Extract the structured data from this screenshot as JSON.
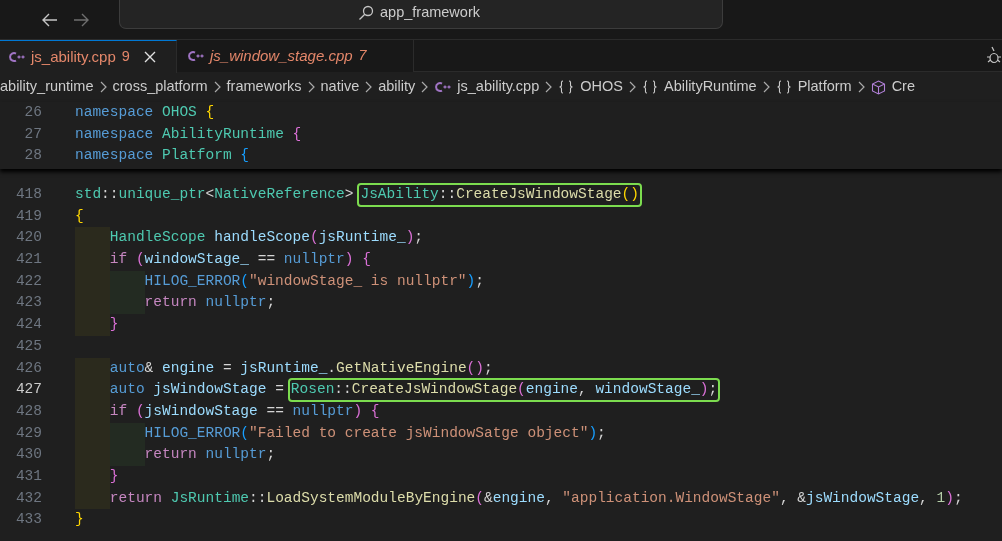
{
  "title_bar": {
    "search": "app_framework"
  },
  "tabs": [
    {
      "label": "js_ability.cpp",
      "badge": "9",
      "selected": true,
      "preview": false
    },
    {
      "label": "js_window_stage.cpp",
      "badge": "7",
      "selected": false,
      "preview": true
    }
  ],
  "breadcrumb": [
    {
      "kind": "folder",
      "label": "ability_runtime"
    },
    {
      "kind": "folder",
      "label": "cross_platform"
    },
    {
      "kind": "folder",
      "label": "frameworks"
    },
    {
      "kind": "folder",
      "label": "native"
    },
    {
      "kind": "folder",
      "label": "ability"
    },
    {
      "kind": "file",
      "label": "js_ability.cpp"
    },
    {
      "kind": "namespace",
      "label": "OHOS"
    },
    {
      "kind": "namespace",
      "label": "AbilityRuntime"
    },
    {
      "kind": "namespace",
      "label": "Platform"
    },
    {
      "kind": "symbol",
      "label": "Cre"
    }
  ],
  "sticky_lines": [
    {
      "num": "26",
      "code": [
        {
          "text": "namespace ",
          "kind": "kw"
        },
        {
          "text": "OHOS ",
          "kind": "type"
        },
        {
          "text": "{",
          "kind": "b1"
        }
      ]
    },
    {
      "num": "27",
      "code": [
        {
          "text": "namespace ",
          "kind": "kw"
        },
        {
          "text": "AbilityRuntime ",
          "kind": "type"
        },
        {
          "text": "{",
          "kind": "b2"
        }
      ]
    },
    {
      "num": "28",
      "code": [
        {
          "text": "namespace ",
          "kind": "kw"
        },
        {
          "text": "Platform ",
          "kind": "type"
        },
        {
          "text": "{",
          "kind": "b3"
        }
      ]
    }
  ],
  "lines": [
    {
      "num": "418",
      "current": false,
      "code": [
        {
          "text": "std",
          "kind": "type"
        },
        {
          "text": "::",
          "kind": "p"
        },
        {
          "text": "unique_ptr",
          "kind": "type"
        },
        {
          "text": "<",
          "kind": "p"
        },
        {
          "text": "NativeReference",
          "kind": "type"
        },
        {
          "text": ">",
          "kind": "p"
        }
      ],
      "boxed": [
        {
          "text": "JsAbility",
          "kind": "type"
        },
        {
          "text": "::",
          "kind": "p"
        },
        {
          "text": "CreateJsWindowStage",
          "kind": "fn"
        },
        {
          "text": "()",
          "kind": "b1"
        }
      ]
    },
    {
      "num": "419",
      "current": false,
      "code": [
        {
          "text": "{",
          "kind": "b1"
        }
      ]
    },
    {
      "num": "420",
      "current": false,
      "code": [
        {
          "text": "    HandleScope ",
          "kind": "type"
        },
        {
          "text": "handleScope",
          "kind": "var"
        },
        {
          "text": "(",
          "kind": "b2"
        },
        {
          "text": "jsRuntime_",
          "kind": "var"
        },
        {
          "text": ")",
          "kind": "b2"
        },
        {
          "text": ";",
          "kind": "p"
        }
      ]
    },
    {
      "num": "421",
      "current": false,
      "code": [
        {
          "text": "    if ",
          "kind": "ctl"
        },
        {
          "text": "(",
          "kind": "b2"
        },
        {
          "text": "windowStage_",
          "kind": "var"
        },
        {
          "text": " == ",
          "kind": "p"
        },
        {
          "text": "nullptr",
          "kind": "kw"
        },
        {
          "text": ") {",
          "kind": "b2"
        }
      ]
    },
    {
      "num": "422",
      "current": false,
      "code": [
        {
          "text": "        HILOG_ERROR",
          "kind": "macro"
        },
        {
          "text": "(",
          "kind": "b3"
        },
        {
          "text": "\"windowStage_ is nullptr\"",
          "kind": "str"
        },
        {
          "text": ")",
          "kind": "b3"
        },
        {
          "text": ";",
          "kind": "p"
        }
      ]
    },
    {
      "num": "423",
      "current": false,
      "code": [
        {
          "text": "        return ",
          "kind": "ctl"
        },
        {
          "text": "nullptr",
          "kind": "kw"
        },
        {
          "text": ";",
          "kind": "p"
        }
      ]
    },
    {
      "num": "424",
      "current": false,
      "code": [
        {
          "text": "    }",
          "kind": "b2"
        }
      ]
    },
    {
      "num": "425",
      "current": false
    },
    {
      "num": "426",
      "current": false,
      "code": [
        {
          "text": "    auto",
          "kind": "kw"
        },
        {
          "text": "& ",
          "kind": "p"
        },
        {
          "text": "engine",
          "kind": "var"
        },
        {
          "text": " = ",
          "kind": "p"
        },
        {
          "text": "jsRuntime_",
          "kind": "var"
        },
        {
          "text": ".",
          "kind": "p"
        },
        {
          "text": "GetNativeEngine",
          "kind": "fn"
        },
        {
          "text": "()",
          "kind": "b2"
        },
        {
          "text": ";",
          "kind": "p"
        }
      ]
    },
    {
      "num": "427",
      "current": true,
      "code": [
        {
          "text": "    auto ",
          "kind": "kw"
        },
        {
          "text": "jsWindowStage",
          "kind": "var"
        },
        {
          "text": " =",
          "kind": "p"
        }
      ],
      "boxed": [
        {
          "text": "Rosen",
          "kind": "type"
        },
        {
          "text": "::",
          "kind": "p"
        },
        {
          "text": "CreateJsWindowStage",
          "kind": "fn"
        },
        {
          "text": "(",
          "kind": "b2"
        },
        {
          "text": "engine",
          "kind": "var"
        },
        {
          "text": ", ",
          "kind": "p"
        },
        {
          "text": "windowStage_",
          "kind": "var"
        },
        {
          "text": ")",
          "kind": "b2"
        },
        {
          "text": ";",
          "kind": "p"
        }
      ]
    },
    {
      "num": "428",
      "current": false,
      "code": [
        {
          "text": "    if ",
          "kind": "ctl"
        },
        {
          "text": "(",
          "kind": "b2"
        },
        {
          "text": "jsWindowStage",
          "kind": "var"
        },
        {
          "text": " == ",
          "kind": "p"
        },
        {
          "text": "nullptr",
          "kind": "kw"
        },
        {
          "text": ") {",
          "kind": "b2"
        }
      ]
    },
    {
      "num": "429",
      "current": false,
      "code": [
        {
          "text": "        HILOG_ERROR",
          "kind": "macro"
        },
        {
          "text": "(",
          "kind": "b3"
        },
        {
          "text": "\"Failed to create jsWindowSatge object\"",
          "kind": "str"
        },
        {
          "text": ")",
          "kind": "b3"
        },
        {
          "text": ";",
          "kind": "p"
        }
      ]
    },
    {
      "num": "430",
      "current": false,
      "code": [
        {
          "text": "        return ",
          "kind": "ctl"
        },
        {
          "text": "nullptr",
          "kind": "kw"
        },
        {
          "text": ";",
          "kind": "p"
        }
      ]
    },
    {
      "num": "431",
      "current": false,
      "code": [
        {
          "text": "    }",
          "kind": "b2"
        }
      ]
    },
    {
      "num": "432",
      "current": false,
      "code": [
        {
          "text": "    return ",
          "kind": "ctl"
        },
        {
          "text": "JsRuntime",
          "kind": "type"
        },
        {
          "text": "::",
          "kind": "p"
        },
        {
          "text": "LoadSystemModuleByEngine",
          "kind": "fn"
        },
        {
          "text": "(",
          "kind": "b2"
        },
        {
          "text": "&",
          "kind": "p"
        },
        {
          "text": "engine",
          "kind": "var"
        },
        {
          "text": ", ",
          "kind": "p"
        },
        {
          "text": "\"application.WindowStage\"",
          "kind": "str"
        },
        {
          "text": ", &",
          "kind": "p"
        },
        {
          "text": "jsWindowStage",
          "kind": "var"
        },
        {
          "text": ", ",
          "kind": "p"
        },
        {
          "text": "1",
          "kind": "num"
        },
        {
          "text": ")",
          "kind": "b2"
        },
        {
          "text": ";",
          "kind": "p"
        }
      ]
    },
    {
      "num": "433",
      "current": false,
      "code": [
        {
          "text": "}",
          "kind": "b1"
        }
      ]
    }
  ]
}
